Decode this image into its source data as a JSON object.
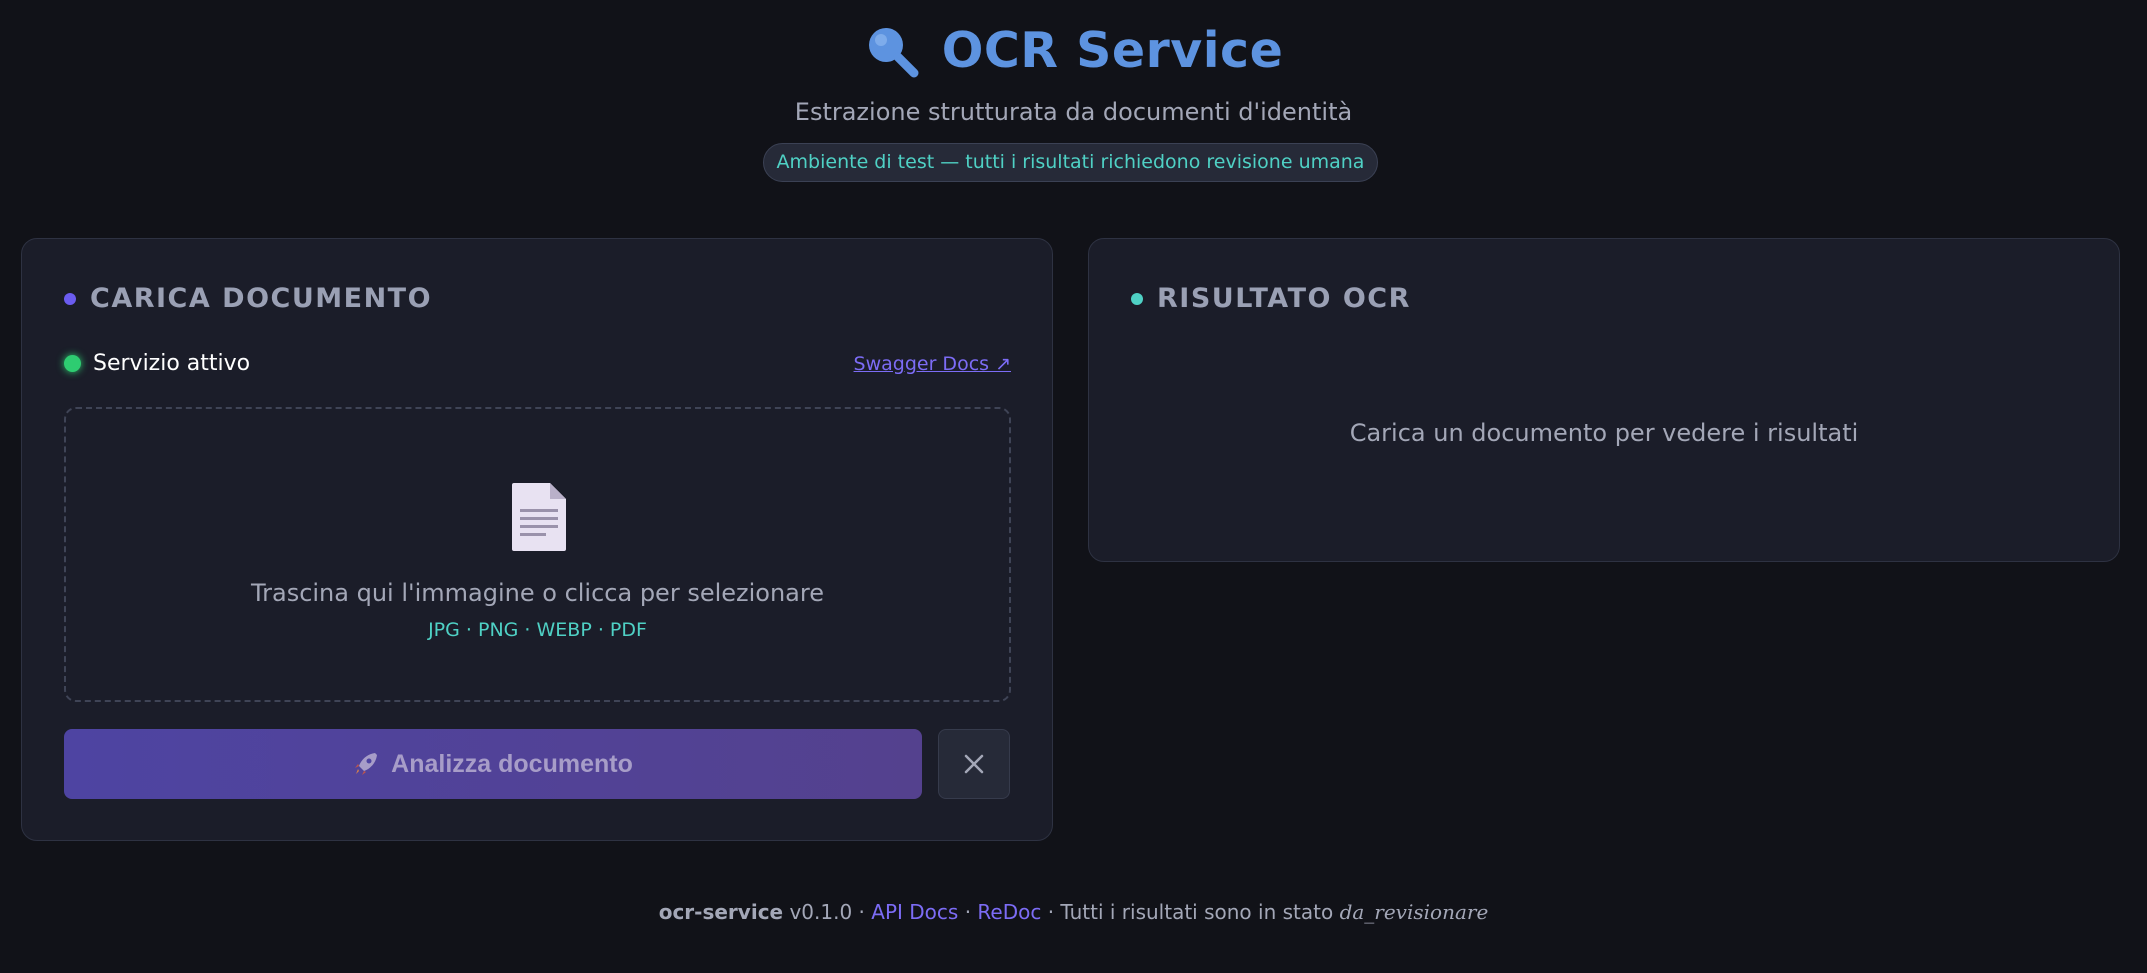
{
  "header": {
    "title": "OCR Service",
    "title_icon": "magnifier-icon",
    "subtitle": "Estrazione strutturata da documenti d'identità",
    "environment_badge": "Ambiente di test — tutti i risultati richiedono revisione umana"
  },
  "upload_panel": {
    "heading": "CARICA DOCUMENTO",
    "status_text": "Servizio attivo",
    "status_color": "#2ecc71",
    "swagger_link": "Swagger Docs ↗",
    "dropzone": {
      "icon": "document-icon",
      "instruction": "Trascina qui l'immagine o clicca per selezionare",
      "formats": "JPG · PNG · WEBP · PDF"
    },
    "analyze_button": "Analizza documento",
    "analyze_icon": "rocket-icon",
    "clear_icon": "close-icon"
  },
  "result_panel": {
    "heading": "RISULTATO OCR",
    "empty_message": "Carica un documento per vedere i risultati"
  },
  "footer": {
    "app_name": "ocr-service",
    "version": "v0.1.0",
    "sep1": " · ",
    "api_docs": "API Docs",
    "sep2": " · ",
    "redoc": "ReDoc",
    "sep3": " · Tutti i risultati sono in stato ",
    "state": "da_revisionare"
  },
  "colors": {
    "accent_blue": "#5d93e0",
    "accent_purple": "#6b5cf0",
    "accent_teal": "#4fd1c5",
    "background": "#111218",
    "panel": "#1b1d29"
  }
}
